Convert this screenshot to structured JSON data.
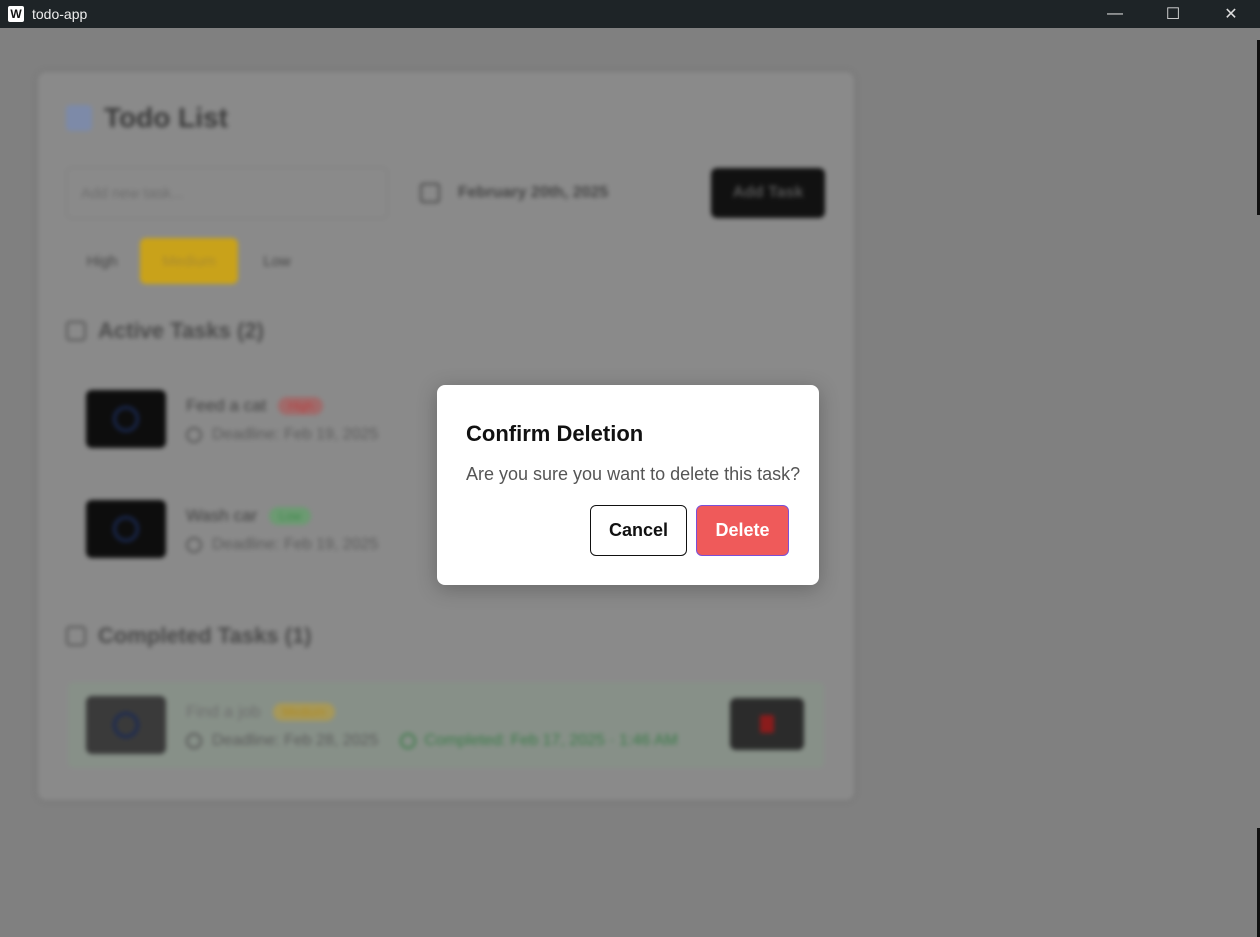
{
  "window": {
    "icon_letter": "W",
    "title": "todo-app",
    "minimize": "—",
    "maximize": "☐",
    "close": "✕"
  },
  "app": {
    "heading": "Todo List",
    "input_placeholder": "Add new task...",
    "date_value": "February 20th, 2025",
    "add_button": "Add Task",
    "priorities": [
      "High",
      "Medium",
      "Low"
    ],
    "selected_priority": "Medium",
    "active_title": "Active Tasks (2)",
    "completed_title": "Completed Tasks (1)",
    "active_tasks": [
      {
        "title": "Feed a cat",
        "priority": "High",
        "deadline": "Deadline: Feb 19, 2025"
      },
      {
        "title": "Wash car",
        "priority": "Low",
        "deadline": "Deadline: Feb 19, 2025"
      }
    ],
    "completed_tasks": [
      {
        "title": "Find a job",
        "priority": "Medium",
        "deadline": "Deadline: Feb 28, 2025",
        "completed": "Completed: Feb 17, 2025 · 1:46 AM"
      }
    ]
  },
  "modal": {
    "title": "Confirm Deletion",
    "message": "Are you sure you want to delete this task?",
    "cancel": "Cancel",
    "delete": "Delete"
  },
  "colors": {
    "overlay": "#808080",
    "delete_button": "#ef5a5a",
    "medium_priority": "#c9a21a"
  }
}
